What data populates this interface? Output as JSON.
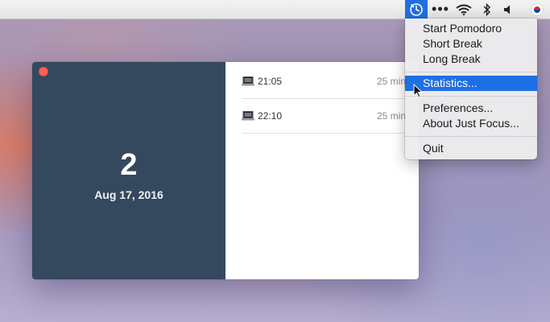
{
  "menubar": {
    "icons": [
      "just-focus-icon",
      "more-icon",
      "wifi-icon",
      "bluetooth-icon",
      "volume-icon",
      "flag-icon"
    ],
    "more_glyph": "•••"
  },
  "window": {
    "pomodoro_count": "2",
    "date": "Aug 17, 2016",
    "sessions": [
      {
        "time": "21:05",
        "duration": "25 min"
      },
      {
        "time": "22:10",
        "duration": "25 min"
      }
    ]
  },
  "menu": {
    "items": [
      {
        "label": "Start Pomodoro"
      },
      {
        "label": "Short Break"
      },
      {
        "label": "Long Break"
      },
      {
        "label": "Statistics..."
      },
      {
        "label": "Preferences..."
      },
      {
        "label": "About Just Focus..."
      },
      {
        "label": "Quit"
      }
    ],
    "highlighted_item": "Statistics..."
  },
  "colors": {
    "left_pane": "#34495e",
    "highlight": "#1e6ee6",
    "close_button": "#fc605b"
  }
}
